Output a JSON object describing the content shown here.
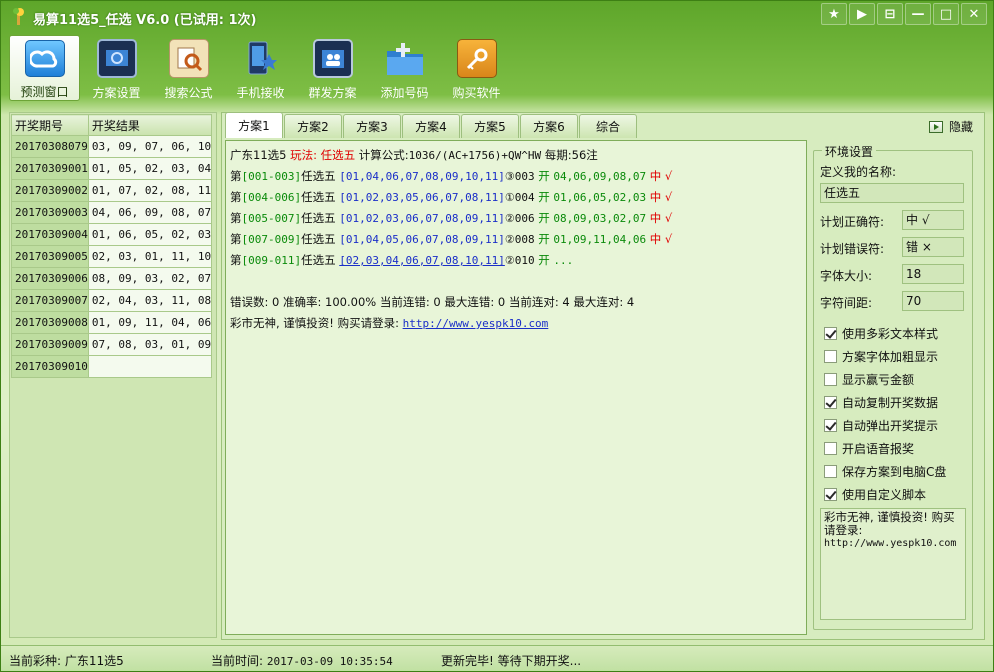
{
  "window": {
    "title": "易算11选5_任选 V6.0 (已试用: 1次)",
    "controls": [
      "★",
      "▶",
      "⊟",
      "—",
      "□",
      "✕"
    ]
  },
  "toolbar": [
    {
      "label": "预测窗口",
      "icon": "cloud-loop-icon",
      "active": true
    },
    {
      "label": "方案设置",
      "icon": "settings-monitor-icon",
      "active": false
    },
    {
      "label": "搜索公式",
      "icon": "search-formula-icon",
      "active": false
    },
    {
      "label": "手机接收",
      "icon": "mobile-receive-icon",
      "active": false
    },
    {
      "label": "群发方案",
      "icon": "group-send-icon",
      "active": false
    },
    {
      "label": "添加号码",
      "icon": "add-number-icon",
      "active": false
    },
    {
      "label": "购买软件",
      "icon": "key-icon",
      "active": false
    }
  ],
  "draws": {
    "headers": [
      "开奖期号",
      "开奖结果"
    ],
    "rows": [
      [
        "20170308079",
        "03, 09, 07, 06, 10"
      ],
      [
        "20170309001",
        "01, 05, 02, 03, 04"
      ],
      [
        "20170309002",
        "01, 07, 02, 08, 11"
      ],
      [
        "20170309003",
        "04, 06, 09, 08, 07"
      ],
      [
        "20170309004",
        "01, 06, 05, 02, 03"
      ],
      [
        "20170309005",
        "02, 03, 01, 11, 10"
      ],
      [
        "20170309006",
        "08, 09, 03, 02, 07"
      ],
      [
        "20170309007",
        "02, 04, 03, 11, 08"
      ],
      [
        "20170309008",
        "01, 09, 11, 04, 06"
      ],
      [
        "20170309009",
        "07, 08, 03, 01, 09"
      ],
      [
        "20170309010",
        ""
      ]
    ]
  },
  "tabs": [
    "方案1",
    "方案2",
    "方案3",
    "方案4",
    "方案5",
    "方案6",
    "综合"
  ],
  "hide_label": "隐藏",
  "result": {
    "header": {
      "lottery": "广东11选5",
      "play_label": "玩法:",
      "play_value": "任选五",
      "formula_label": "计算公式:",
      "formula_value": "1036/(AC+1756)+QW^HW",
      "period_label": "每期:",
      "period_value": "56注"
    },
    "lines": [
      {
        "range": "[001-003]",
        "type": "任选五",
        "nums": "[01,04,06,07,08,09,10,11]",
        "idx": "③003",
        "open_label": "开",
        "open_nums": "04,06,09,08,07",
        "status": "中",
        "mark": "√",
        "underline": false
      },
      {
        "range": "[004-006]",
        "type": "任选五",
        "nums": "[01,02,03,05,06,07,08,11]",
        "idx": "①004",
        "open_label": "开",
        "open_nums": "01,06,05,02,03",
        "status": "中",
        "mark": "√",
        "underline": false
      },
      {
        "range": "[005-007]",
        "type": "任选五",
        "nums": "[01,02,03,06,07,08,09,11]",
        "idx": "②006",
        "open_label": "开",
        "open_nums": "08,09,03,02,07",
        "status": "中",
        "mark": "√",
        "underline": false
      },
      {
        "range": "[007-009]",
        "type": "任选五",
        "nums": "[01,04,05,06,07,08,09,11]",
        "idx": "②008",
        "open_label": "开",
        "open_nums": "01,09,11,04,06",
        "status": "中",
        "mark": "√",
        "underline": false
      },
      {
        "range": "[009-011]",
        "type": "任选五",
        "nums": "[02,03,04,06,07,08,10,11]",
        "idx": "②010",
        "open_label": "开",
        "open_nums": "...",
        "status": "",
        "mark": "",
        "underline": true
      }
    ],
    "stats": "错误数: 0 准确率: 100.00% 当前连错: 0 最大连错: 0 当前连对: 4 最大连对: 4",
    "footer_text": "彩市无神, 谨慎投资! 购买请登录:",
    "footer_url": "http://www.yespk10.com",
    "line_prefix": "第"
  },
  "settings": {
    "legend": "环境设置",
    "name_label": "定义我的名称:",
    "name_value": "任选五",
    "correct_label": "计划正确符:",
    "correct_value": "中 √",
    "wrong_label": "计划错误符:",
    "wrong_value": "错 ×",
    "fontsize_label": "字体大小:",
    "fontsize_value": "18",
    "spacing_label": "字符间距:",
    "spacing_value": "70",
    "checkboxes": [
      {
        "label": "使用多彩文本样式",
        "checked": true
      },
      {
        "label": "方案字体加粗显示",
        "checked": false
      },
      {
        "label": "显示赢亏金额",
        "checked": false
      },
      {
        "label": "自动复制开奖数据",
        "checked": true
      },
      {
        "label": "自动弹出开奖提示",
        "checked": true
      },
      {
        "label": "开启语音报奖",
        "checked": false
      },
      {
        "label": "保存方案到电脑C盘",
        "checked": false
      },
      {
        "label": "使用自定义脚本",
        "checked": true
      }
    ],
    "note_text": "彩市无神, 谨慎投资! 购买请登录:",
    "note_url": "http://www.yespk10.com"
  },
  "status": {
    "lottery_label": "当前彩种:",
    "lottery_value": "广东11选5",
    "time_label": "当前时间:",
    "time_value": "2017-03-09 10:35:54",
    "message": "更新完毕! 等待下期开奖..."
  },
  "colors": {
    "accent_red": "#e00000",
    "number_blue": "#1a2ec8",
    "open_green": "#0a8a0a"
  }
}
